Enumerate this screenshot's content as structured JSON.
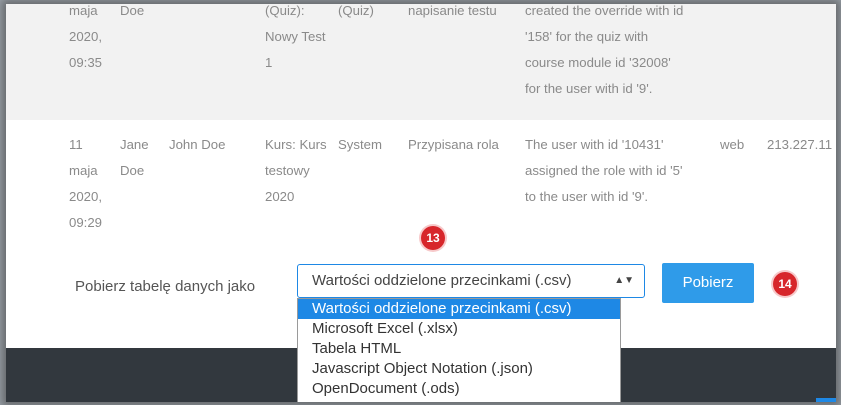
{
  "table_rows": [
    {
      "date": [
        "maja",
        "2020,",
        "09:35"
      ],
      "user": [
        "Doe"
      ],
      "affected": [],
      "context": [
        "(Quiz):",
        "Nowy Test",
        "1"
      ],
      "component": [
        "(Quiz)"
      ],
      "event": [
        "napisanie testu"
      ],
      "description": [
        "created the override with id",
        "'158' for the quiz with",
        "course module id '32008'",
        "for the user with id '9'."
      ],
      "origin": [],
      "ip": []
    },
    {
      "date": [
        "11",
        "maja",
        "2020,",
        "09:29"
      ],
      "user": [
        "Jane",
        "Doe"
      ],
      "affected": [
        "John Doe"
      ],
      "context": [
        "Kurs: Kurs",
        "testowy",
        "2020"
      ],
      "component": [
        "System"
      ],
      "event": [
        "Przypisana rola"
      ],
      "description": [
        "The user with id '10431'",
        "assigned the role with id '5'",
        "to the user with id '9'."
      ],
      "origin": [
        "web"
      ],
      "ip": [
        "213.227.11"
      ]
    }
  ],
  "download": {
    "label": "Pobierz tabelę danych jako",
    "selected": "Wartości oddzielone przecinkami (.csv)",
    "arrow_glyph": "▲▼",
    "button": "Pobierz",
    "options": [
      "Wartości oddzielone przecinkami (.csv)",
      "Microsoft Excel (.xlsx)",
      "Tabela HTML",
      "Javascript Object Notation (.json)",
      "OpenDocument (.ods)"
    ]
  },
  "badges": {
    "first": "13",
    "second": "14"
  },
  "colors": {
    "accent": "#1e88e5",
    "button": "#2f9be9",
    "badge": "#d7262b",
    "footer": "#32383e"
  }
}
